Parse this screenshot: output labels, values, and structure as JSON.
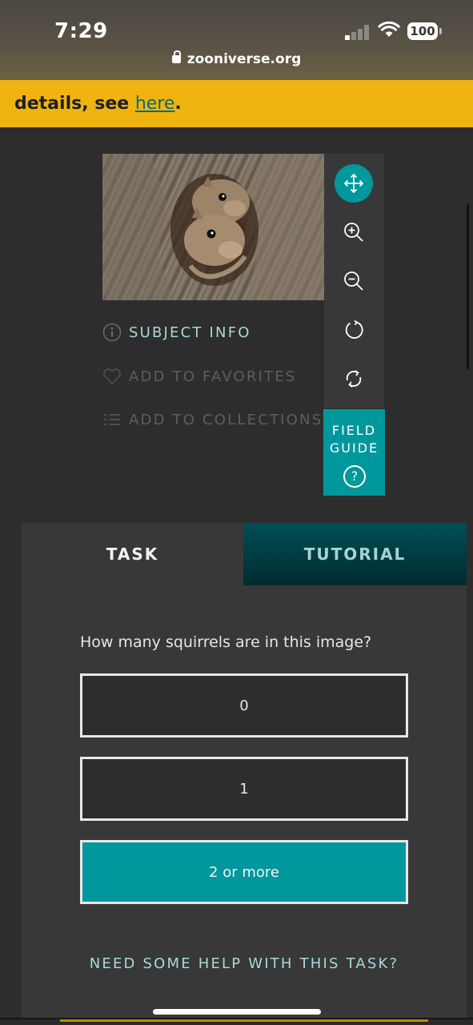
{
  "status_bar": {
    "time": "7:29",
    "battery": "100",
    "url": "zooniverse.org"
  },
  "banner": {
    "text": "details, see ",
    "link": "here",
    "suffix": "."
  },
  "subject": {
    "toolbar": [
      "move-icon",
      "zoom-in-icon",
      "zoom-out-icon",
      "rotate-icon",
      "reset-icon"
    ],
    "field_guide": {
      "line1": "FIELD",
      "line2": "GUIDE",
      "icon": "?"
    },
    "meta": {
      "info": "SUBJECT INFO",
      "favorites": "ADD TO FAVORITES",
      "collections": "ADD TO COLLECTIONS"
    }
  },
  "tabs": {
    "task": "TASK",
    "tutorial": "TUTORIAL"
  },
  "task": {
    "question": "How many squirrels are in this image?",
    "answers": [
      "0",
      "1",
      "2 or more"
    ],
    "help": "NEED SOME HELP WITH THIS TASK?"
  },
  "colors": {
    "accent": "#00979d",
    "banner": "#efb410",
    "background": "#2d2d2d"
  }
}
